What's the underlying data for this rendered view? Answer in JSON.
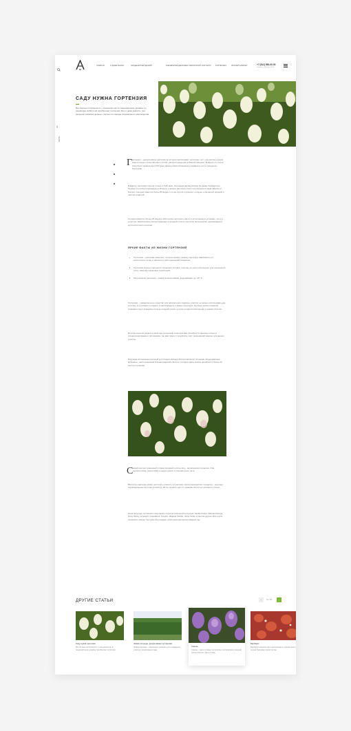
{
  "header": {
    "logo": "A",
    "nav": [
      "ГЛАВНАЯ",
      "О ДОМЕ МАРИИ",
      "ЛАНДШАФТНЫЙ ДИЗАЙН",
      "ОЗЕЛЕНЕНИЕ ДВОРОВЫХ ТЕРРИТОРИЙ",
      "КОНТАКТЫ",
      "ПОРТФОЛИО",
      "ЛИЧНЫЙ КАБИНЕТ"
    ],
    "phone": "+7 (812) 565-90-03",
    "phone_sub": "Звоните с 10:00 до 19:00"
  },
  "side": {
    "lang": "EN",
    "nav_text": "МЕНЮ"
  },
  "hero": {
    "title": "САДУ НУЖНА ГОРТЕНЗИЯ",
    "lead": "Все больше популярность у специалистов по ландшафтному дизайну и у садоводов-любителей приобретает гортензия. Мое и деже живость, она уверенно занимает верные строчки хит-парада современного цветоводства."
  },
  "article": {
    "intro_dropcap": "Г",
    "intro": "ортензия – декоративное растение (в истории насчитывает несколько лет), она росла в диком виде в горных лесах Японии и Китая, распространенная в Южной Америке. В Европу из лесов Азии была привезена в XVIII веке французским ботаником и названа в честь принцессы Гортензии.",
    "p2": "В Европу гортензия попала только в XVIII веке, благодаря французскому ботанику Коммерсону. Первые сорта были выведены в Японии, и вскоре растение стало популярным в садах Европы и России. Сегодня известно более 80 видов и сотни сортов гортензии, которые отличаются формой и цветом соцветий.",
    "p3": "Сегодня известно более 35 видов и 100 сортов гортензии, как их в естественных условиях, так и в культуре. Наибольшее распространение в средней полосе получили метельчатая, древовидная и крупнолистная гортензии.",
    "facts_title": "ЯРКИЕ ФАКТЫ ИЗ ЖИЗНИ ГОРТЕНЗИЙ",
    "facts": [
      "Гортензия – растение-хамелеон, которое меняет окраску цветков в зависимости от кислотности почвы и наличия в ней соединений алюминия.",
      "Гортензия хорошо переносит городские условия, поэтому ее часто используют для озеленения улиц, скверов и дворовых территорий.",
      "Метельчатая гортензия – самая морозостойкая, выдерживает до -35 °С."
    ],
    "p4": "Гортензия – универсальное средство для оформления садового участка: ее можно использовать как солитер, в групповых посадках, в миксбордерах и живых изгородях. Крупные шапки соцветий украшают сад с середины лета до поздней осени, а сухие соцветия используют в зимних букетах.",
    "p5": "Если вы решили украсить свой сад гортензией, советуем вам приобрести саженцы только в специализированных питомниках, где вам помогут подобрать сорт, подходящий именно для вашего участка.",
    "p6": "Ведущим питомником растений для Северо-Запада России является питомник «Ландшафтные Дубравы», расположенный в Ленинградской области. Сегодня здесь можно приобрести более 20 сортов гортензии.",
    "p7_dropcap": "С",
    "p7": "амый распространенный в садах средней полосы вид – метельчатая гортензия. Она неприхотлива, зимостойка и щедро цветет в течение всего лета.",
    "p8": "Взрослое растение может достигать в высоту 2-3 метров, крона раскидистая. Соцветия – крупные пирамидальные метелки длиной до 30 см, меняют цвет от кремово-белого до розового к осени.",
    "p9": "Наши ведущие питомники предлагают сорта метельчатой гортензии: Vanille Fraise, Diamant Rouge, Pinky Winky, Limelight, Grandiflora, Kyushu, Magical Candle, Silver Dollar и многие другие. Все сорта прекрасно зимуют без укрытия и радуют обильным цветением каждый год."
  },
  "others": {
    "title": "ДРУГИЕ СТАТЬИ",
    "pager": "01 / 05",
    "items": [
      {
        "title": "Саду нужна гортензия",
        "text": "Все больше популярность у специалистов по ландшафтному дизайну приобретает гортензия."
      },
      {
        "title": "Живая изгородь: декоративные кустарники",
        "text": "Живая изгородь – прекрасное решение для ограждения участка и зонирования сада."
      },
      {
        "title": "Сирень",
        "text": "Сирень – один из самых популярных кустарников в средней полосе России, цветет в мае."
      },
      {
        "title": "Барбарис",
        "text": "Барбарис неприхотлив и декоративен в течение всего сезона благодаря яркой листве."
      }
    ]
  }
}
